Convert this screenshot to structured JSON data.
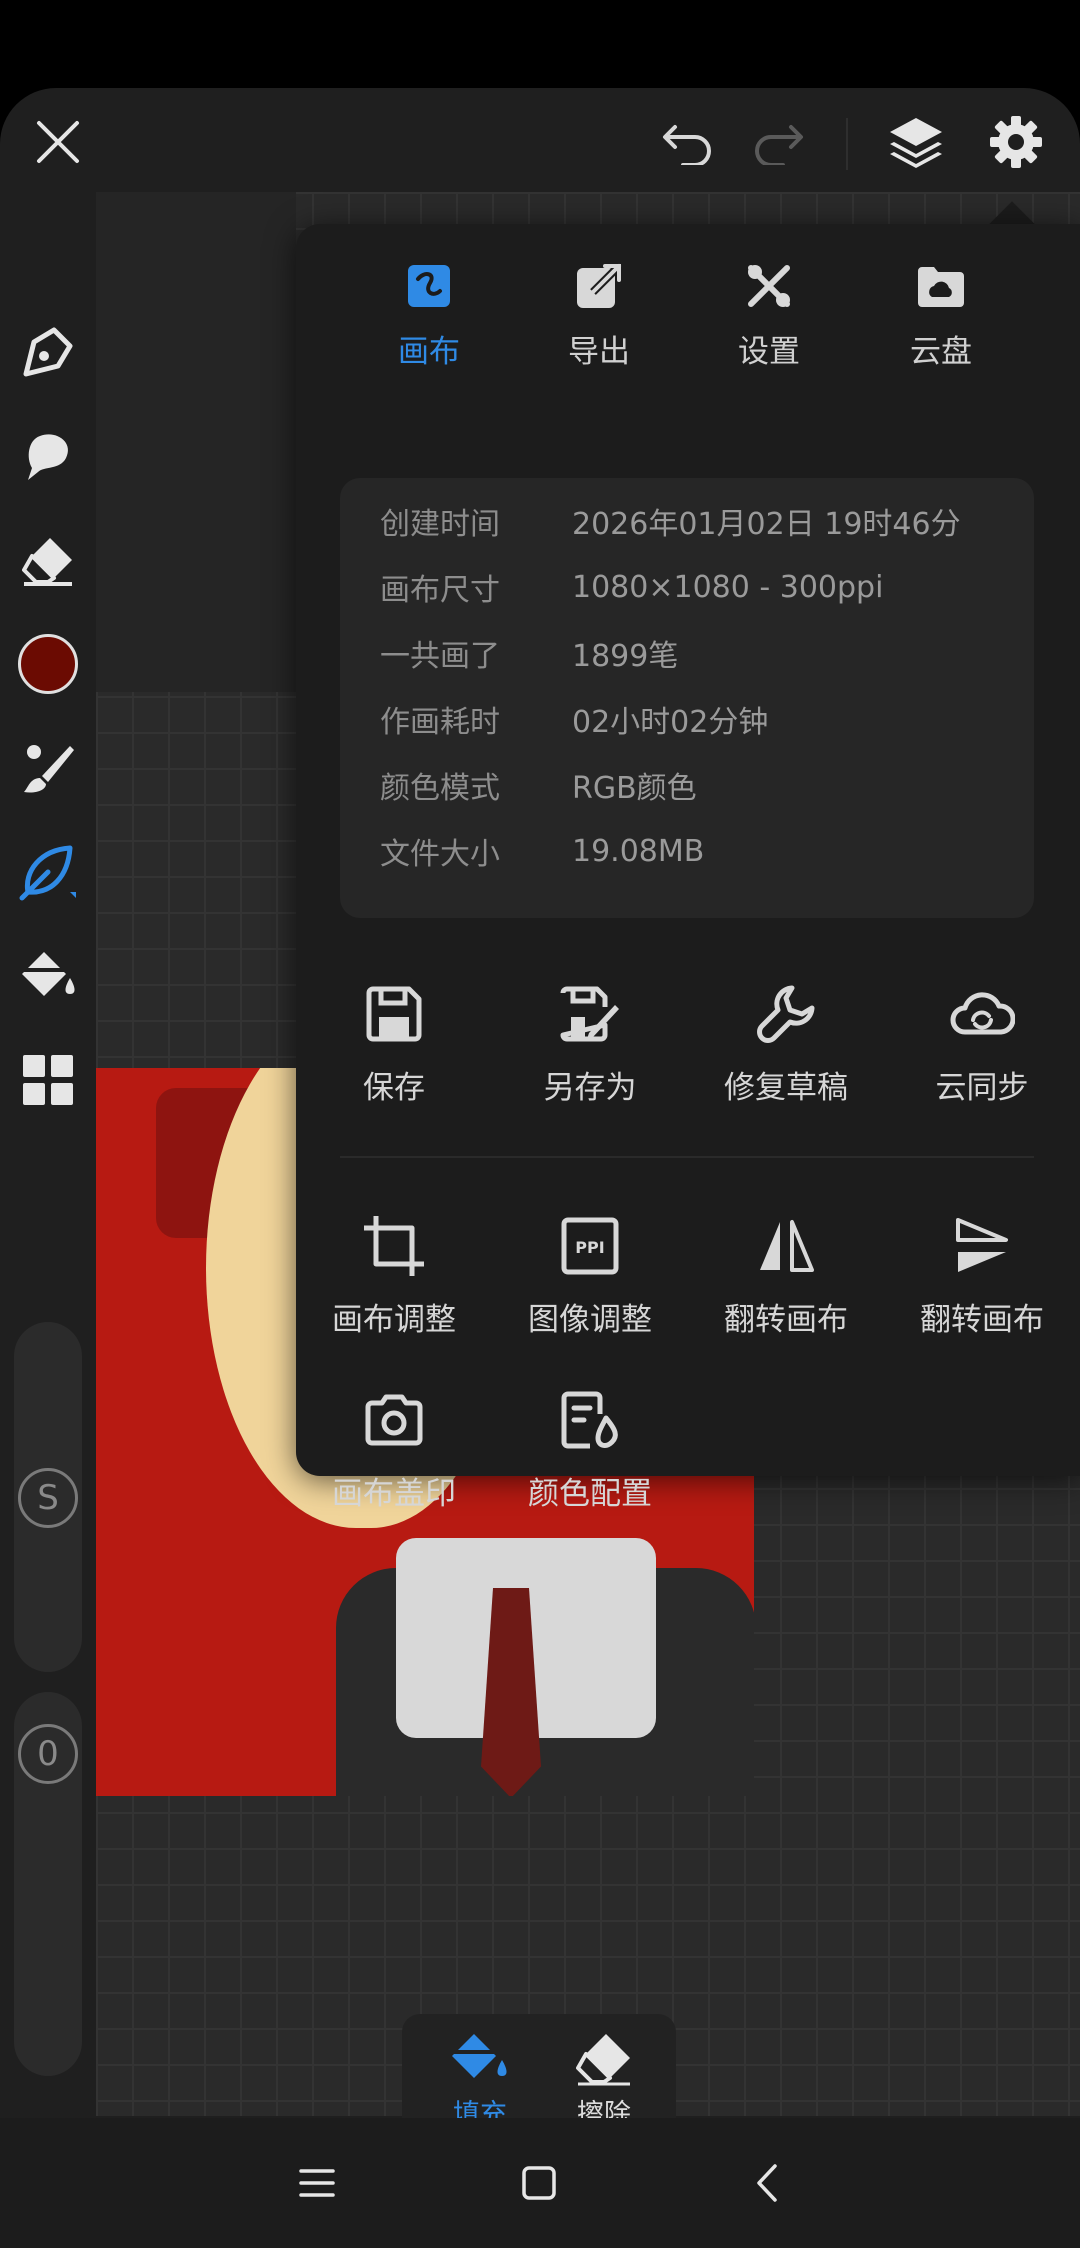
{
  "tabs": [
    {
      "label": "画布",
      "icon": "canvas-icon",
      "active": true
    },
    {
      "label": "导出",
      "icon": "export-icon",
      "active": false
    },
    {
      "label": "设置",
      "icon": "settings-tools-icon",
      "active": false
    },
    {
      "label": "云盘",
      "icon": "cloud-drive-icon",
      "active": false
    }
  ],
  "info": [
    {
      "key": "创建时间",
      "value": "2026年01月02日 19时46分"
    },
    {
      "key": "画布尺寸",
      "value": "1080×1080 - 300ppi"
    },
    {
      "key": "一共画了",
      "value": "1899笔"
    },
    {
      "key": "作画耗时",
      "value": "02小时02分钟"
    },
    {
      "key": "颜色模式",
      "value": "RGB颜色"
    },
    {
      "key": "文件大小",
      "value": "19.08MB"
    }
  ],
  "file_actions": [
    {
      "label": "保存",
      "icon": "save-icon"
    },
    {
      "label": "另存为",
      "icon": "save-as-icon"
    },
    {
      "label": "修复草稿",
      "icon": "wrench-icon"
    },
    {
      "label": "云同步",
      "icon": "cloud-sync-icon"
    }
  ],
  "canvas_actions": [
    {
      "label": "画布调整",
      "icon": "crop-icon"
    },
    {
      "label": "图像调整",
      "icon": "ppi-icon"
    },
    {
      "label": "翻转画布",
      "icon": "flip-horizontal-icon"
    },
    {
      "label": "翻转画布",
      "icon": "flip-vertical-icon"
    },
    {
      "label": "画布盖印",
      "icon": "camera-icon"
    },
    {
      "label": "颜色配置",
      "icon": "color-config-icon"
    }
  ],
  "sliders": {
    "size_label": "S",
    "opacity_label": "0"
  },
  "minibar": [
    {
      "label": "填充",
      "icon": "fill-bucket-icon",
      "active": true
    },
    {
      "label": "擦除",
      "icon": "eraser-icon",
      "active": false
    }
  ],
  "colors": {
    "accent": "#2f8ae5",
    "current_brush_color": "#6b0b02"
  }
}
